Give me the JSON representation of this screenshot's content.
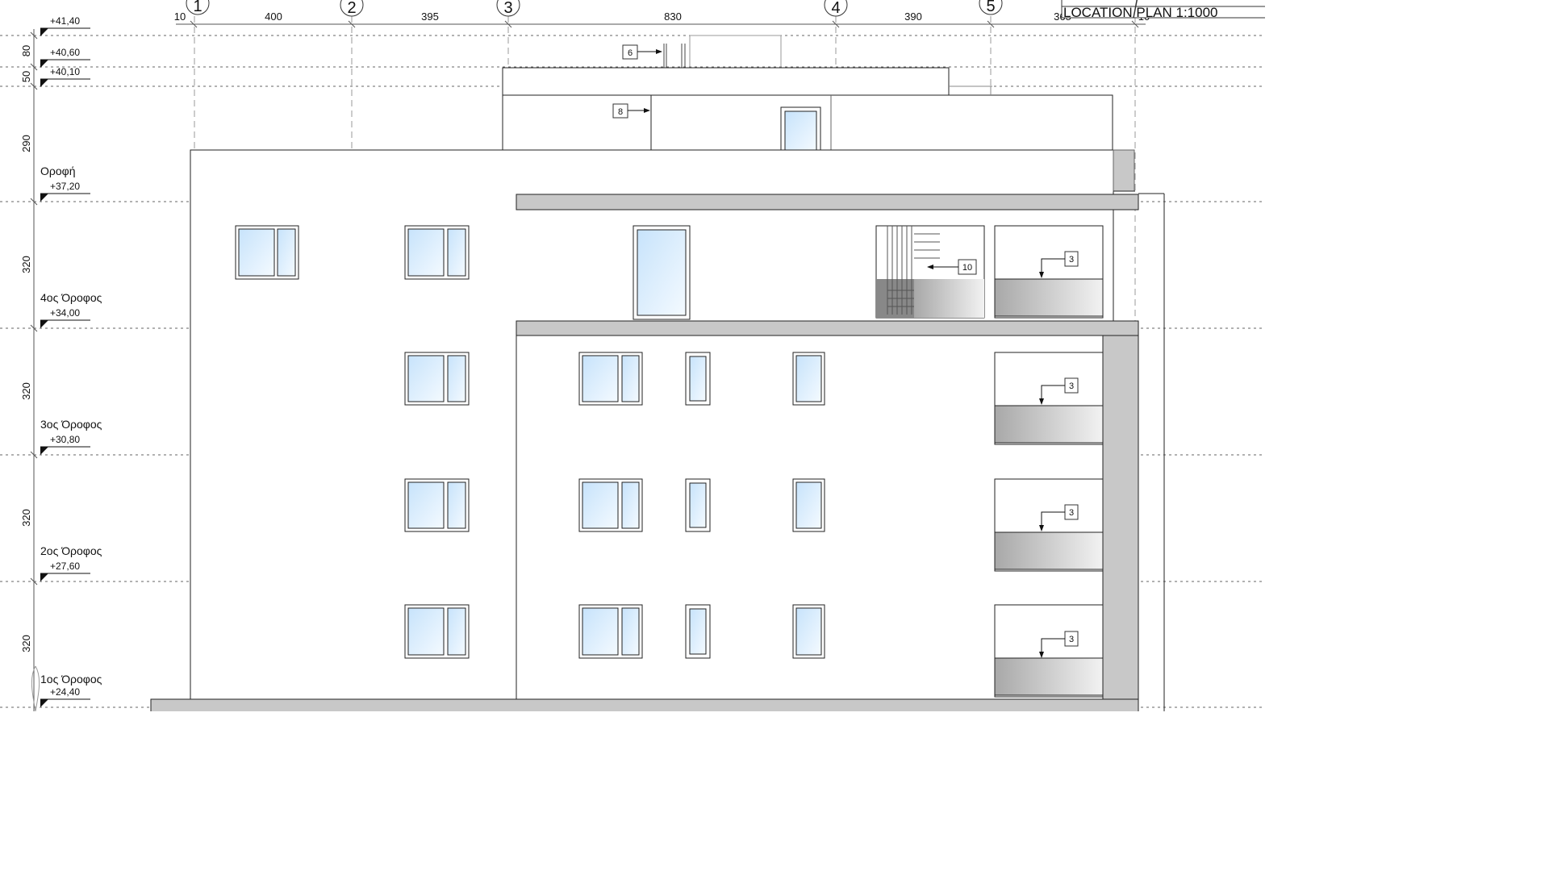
{
  "title_block": {
    "location_plan": "LOCATION PLAN 1:1000"
  },
  "grid_axes": [
    "1",
    "2",
    "3",
    "4",
    "5"
  ],
  "horizontal_dimensions": [
    "10",
    "400",
    "395",
    "830",
    "390",
    "365",
    "10"
  ],
  "vertical_dimensions": [
    "80",
    "50",
    "290",
    "320",
    "320",
    "320",
    "320"
  ],
  "levels": [
    {
      "name": "",
      "value": "+41,40"
    },
    {
      "name": "",
      "value": "+40,60"
    },
    {
      "name": "",
      "value": "+40,10"
    },
    {
      "name": "Οροφή",
      "value": "+37,20"
    },
    {
      "name": "4ος Όροφος",
      "value": "+34,00"
    },
    {
      "name": "3ος Όροφος",
      "value": "+30,80"
    },
    {
      "name": "2ος Όροφος",
      "value": "+27,60"
    },
    {
      "name": "1ος Όροφος",
      "value": "+24,40"
    }
  ],
  "callouts": [
    "6",
    "8",
    "10",
    "3",
    "3",
    "3",
    "3"
  ],
  "colors": {
    "line": "#222222",
    "slab": "#c8c8c8",
    "glass_light": "#eaf4ff",
    "glass_dark": "#b9dcf8",
    "grid": "#888888"
  }
}
